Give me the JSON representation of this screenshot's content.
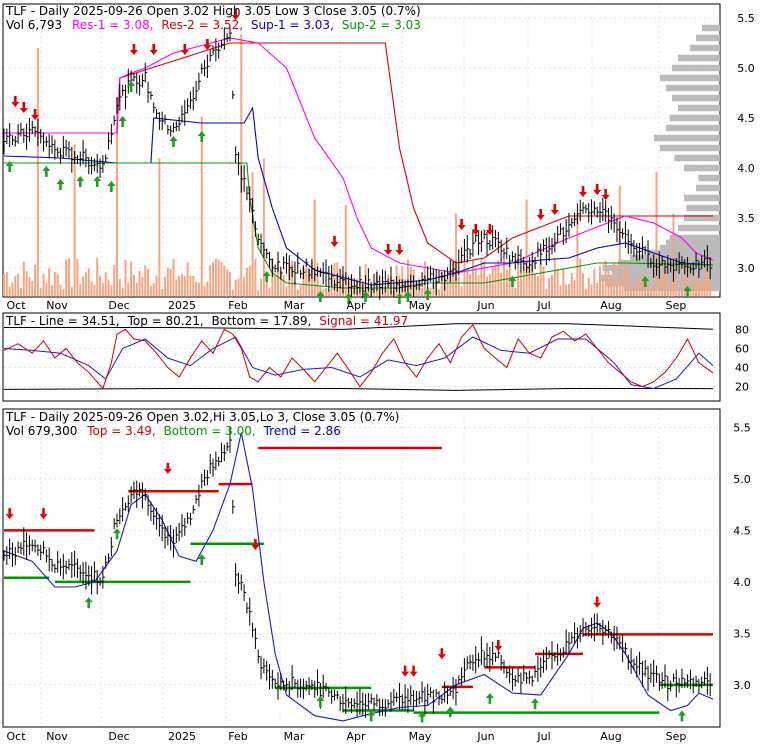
{
  "colors": {
    "res1": "#ff00ff",
    "res2": "#dd0000",
    "sup1": "#0000cc",
    "sup2": "#009900",
    "volume": "#f4a582",
    "volprofile": "#bbbbbb",
    "price": "#000000",
    "up_arrow": "#1f9e1f",
    "down_arrow": "#e00000",
    "signal": "#cc0000",
    "trend": "#1a1acc",
    "grid": "#cccccc"
  },
  "chart_data": [
    {
      "type": "line",
      "panel": "price-support-resistance",
      "header": {
        "title": "TLF - Daily 2025-09-26 Open 3.02  High 3.05  Low 3  Close 3.05 (0.7%)",
        "vol": "Vol 6,793",
        "res1": "Res-1 = 3.08,",
        "res2": "Res-2 = 3.52,",
        "sup1": "Sup-1 = 3.03,",
        "sup2": "Sup-2 = 3.03"
      },
      "x_tick_labels": [
        "Oct",
        "Nov",
        "Dec",
        "2025",
        "Feb",
        "Mar",
        "Apr",
        "May",
        "Jun",
        "Jul",
        "Aug",
        "Sep"
      ],
      "y_tick_labels": [
        "5.5",
        "5.0",
        "4.5",
        "4.0",
        "3.5",
        "3.0"
      ],
      "ylim": [
        2.72,
        5.62
      ],
      "x_range": [
        0,
        251
      ],
      "price_anchors": {
        "x": [
          0,
          10,
          18,
          28,
          35,
          40,
          45,
          50,
          52,
          55,
          58,
          62,
          66,
          70,
          74,
          78,
          80,
          82,
          87,
          90,
          95,
          98,
          100,
          110,
          120,
          130,
          140,
          150,
          160,
          162,
          168,
          175,
          180,
          185,
          190,
          195,
          200,
          205,
          210,
          215,
          220,
          228,
          235,
          240,
          245,
          251
        ],
        "y": [
          4.25,
          4.38,
          4.18,
          4.1,
          4.02,
          4.65,
          4.85,
          4.9,
          4.7,
          4.5,
          4.4,
          4.45,
          4.65,
          4.95,
          5.15,
          5.3,
          5.35,
          4.1,
          3.7,
          3.25,
          3.05,
          2.98,
          3.02,
          2.98,
          2.85,
          2.82,
          2.85,
          2.88,
          2.95,
          3.1,
          3.3,
          3.25,
          3.1,
          3.05,
          3.15,
          3.3,
          3.4,
          3.55,
          3.6,
          3.5,
          3.3,
          3.1,
          3.02,
          3.05,
          3.02,
          3.05
        ]
      },
      "volume_spikes": {
        "x": [
          12,
          25,
          40,
          55,
          70,
          84,
          88,
          92,
          110,
          121,
          160,
          185,
          203,
          218,
          231,
          237
        ],
        "y": [
          0.9,
          0.55,
          0.72,
          0.5,
          0.65,
          0.95,
          0.45,
          0.5,
          0.35,
          0.33,
          0.3,
          0.35,
          0.3,
          0.4,
          0.45,
          0.3
        ]
      },
      "res1": {
        "x": [
          0,
          40,
          41,
          45,
          50,
          60,
          80,
          90,
          100,
          110,
          120,
          125,
          130,
          140,
          160,
          180,
          200,
          220,
          230,
          240,
          245,
          251
        ],
        "y": [
          4.35,
          4.35,
          4.9,
          4.95,
          5.0,
          5.15,
          5.3,
          5.25,
          5.0,
          4.3,
          3.9,
          3.5,
          3.2,
          3.05,
          2.95,
          3.05,
          3.3,
          3.52,
          3.45,
          3.3,
          3.15,
          3.08
        ]
      },
      "res2": {
        "x": [
          0,
          40,
          41,
          80,
          120,
          135,
          140,
          145,
          150,
          160,
          170,
          180,
          200,
          220,
          251
        ],
        "y": [
          4.35,
          4.35,
          4.9,
          5.25,
          5.25,
          5.25,
          4.2,
          3.6,
          3.25,
          3.05,
          3.1,
          3.3,
          3.52,
          3.52,
          3.52
        ]
      },
      "sup1": {
        "x": [
          0,
          20,
          40,
          52,
          53,
          70,
          75,
          85,
          88,
          90,
          95,
          100,
          110,
          130,
          150,
          160,
          165,
          170,
          180,
          190,
          200,
          210,
          220,
          230,
          240,
          251
        ],
        "y": [
          4.12,
          4.1,
          4.05,
          4.05,
          4.5,
          4.45,
          4.45,
          4.45,
          4.6,
          4.1,
          3.6,
          3.2,
          2.98,
          2.83,
          2.88,
          2.95,
          3.0,
          3.05,
          3.05,
          3.08,
          3.1,
          3.2,
          3.25,
          3.15,
          3.05,
          3.03
        ]
      },
      "sup2": {
        "x": [
          0,
          86,
          87,
          90,
          95,
          100,
          120,
          140,
          150,
          170,
          180,
          190,
          200,
          210,
          215,
          220,
          251
        ],
        "y": [
          4.05,
          4.05,
          3.7,
          3.2,
          2.95,
          2.85,
          2.8,
          2.8,
          2.85,
          2.85,
          2.9,
          2.95,
          3.0,
          3.05,
          3.05,
          3.05,
          3.03
        ]
      },
      "up_arrows": {
        "x": [
          2,
          15,
          20,
          27,
          33,
          38,
          42,
          45,
          60,
          70,
          93,
          112,
          122,
          128,
          140,
          143,
          150,
          180,
          227,
          242
        ],
        "y": [
          4.1,
          4.05,
          3.92,
          3.95,
          3.95,
          3.9,
          4.55,
          4.9,
          4.35,
          4.4,
          3.0,
          2.8,
          2.78,
          2.8,
          2.78,
          2.8,
          2.82,
          2.95,
          2.95,
          2.85
        ]
      },
      "down_arrows": {
        "x": [
          4,
          7,
          11,
          46,
          53,
          64,
          72,
          82,
          117,
          136,
          140,
          162,
          167,
          172,
          190,
          195,
          205,
          210,
          213
        ],
        "y": [
          4.58,
          4.52,
          4.45,
          5.1,
          5.1,
          5.1,
          5.15,
          5.45,
          3.18,
          3.1,
          3.1,
          3.35,
          3.3,
          3.3,
          3.45,
          3.5,
          3.68,
          3.7,
          3.65
        ]
      },
      "volume_profile": {
        "price": [
          2.8,
          2.85,
          2.9,
          2.95,
          3.0,
          3.05,
          3.1,
          3.15,
          3.2,
          3.25,
          3.3,
          3.4,
          3.5,
          3.6,
          3.7,
          3.8,
          3.9,
          4.0,
          4.1,
          4.2,
          4.3,
          4.4,
          4.5,
          4.6,
          4.7,
          4.8,
          4.9,
          5.0,
          5.1,
          5.2,
          5.3,
          5.4
        ],
        "weight": [
          0.8,
          0.95,
          1.0,
          0.9,
          0.98,
          0.85,
          0.75,
          0.6,
          0.5,
          0.45,
          0.42,
          0.35,
          0.3,
          0.28,
          0.3,
          0.2,
          0.18,
          0.3,
          0.38,
          0.5,
          0.55,
          0.45,
          0.42,
          0.35,
          0.4,
          0.45,
          0.5,
          0.4,
          0.35,
          0.25,
          0.2,
          0.15
        ]
      }
    },
    {
      "type": "line",
      "panel": "oscillator",
      "header": {
        "title": "TLF - Line = 34.51,",
        "top": "Top = 80.21,",
        "bottom": "Bottom = 17.89,",
        "signal": "Signal = 41.97"
      },
      "y_tick_labels": [
        "80",
        "60",
        "40",
        "20"
      ],
      "ylim": [
        8,
        92
      ],
      "x_range": [
        0,
        251
      ],
      "line": {
        "x": [
          0,
          5,
          10,
          14,
          18,
          22,
          26,
          30,
          35,
          38,
          40,
          43,
          46,
          50,
          54,
          58,
          62,
          66,
          70,
          74,
          78,
          81,
          84,
          87,
          90,
          94,
          98,
          102,
          106,
          110,
          114,
          118,
          122,
          126,
          130,
          134,
          138,
          142,
          146,
          150,
          154,
          158,
          162,
          166,
          170,
          174,
          178,
          182,
          186,
          190,
          194,
          198,
          202,
          206,
          210,
          214,
          218,
          222,
          226,
          230,
          234,
          238,
          242,
          246,
          251
        ],
        "y": [
          58,
          65,
          55,
          68,
          50,
          60,
          45,
          35,
          18,
          45,
          75,
          80,
          70,
          68,
          55,
          40,
          30,
          50,
          68,
          55,
          80,
          75,
          60,
          30,
          25,
          40,
          30,
          50,
          38,
          25,
          40,
          55,
          38,
          20,
          35,
          55,
          70,
          45,
          30,
          50,
          65,
          45,
          72,
          85,
          60,
          50,
          40,
          70,
          55,
          50,
          72,
          78,
          68,
          75,
          60,
          45,
          35,
          25,
          20,
          25,
          35,
          50,
          70,
          45,
          34.51
        ]
      },
      "signal": {
        "x": [
          0,
          10,
          20,
          30,
          36,
          42,
          50,
          58,
          66,
          74,
          82,
          88,
          96,
          106,
          116,
          126,
          136,
          146,
          156,
          166,
          176,
          186,
          196,
          206,
          216,
          222,
          230,
          238,
          246,
          251
        ],
        "y": [
          60,
          58,
          55,
          42,
          28,
          60,
          70,
          50,
          42,
          60,
          72,
          40,
          32,
          38,
          40,
          30,
          48,
          42,
          50,
          72,
          58,
          55,
          70,
          70,
          45,
          22,
          18,
          28,
          55,
          41.97
        ]
      },
      "top_band": {
        "x": [
          0,
          60,
          120,
          160,
          200,
          251
        ],
        "y": [
          82,
          82,
          80,
          86,
          86,
          80.21
        ]
      },
      "bottom_band": {
        "x": [
          0,
          60,
          120,
          160,
          200,
          251
        ],
        "y": [
          17,
          18,
          18,
          16,
          18,
          17.89
        ]
      }
    },
    {
      "type": "line",
      "panel": "price-trend",
      "header": {
        "title": "TLF - Daily 2025-09-26 Open 3.02,Hi 3.05,Lo 3,  Close 3.05 (0.7%)",
        "vol": "Vol 679,300",
        "top": "Top = 3.49,",
        "bottom": "Bottom = 3.00,",
        "trend": "Trend = 2.86"
      },
      "x_tick_labels": [
        "Oct",
        "Nov",
        "Dec",
        "2025",
        "Feb",
        "Mar",
        "Apr",
        "May",
        "Jun",
        "Jul",
        "Aug",
        "Sep"
      ],
      "y_tick_labels": [
        "5.5",
        "5.0",
        "4.5",
        "4.0",
        "3.5",
        "3.0"
      ],
      "ylim": [
        2.6,
        5.65
      ],
      "x_range": [
        0,
        251
      ],
      "trend": {
        "x": [
          0,
          10,
          18,
          25,
          32,
          40,
          45,
          50,
          56,
          62,
          68,
          74,
          80,
          84,
          88,
          92,
          96,
          100,
          110,
          120,
          130,
          140,
          150,
          160,
          170,
          180,
          190,
          200,
          205,
          210,
          215,
          220,
          228,
          236,
          242,
          246,
          251
        ],
        "y": [
          4.3,
          4.2,
          3.95,
          3.95,
          4.0,
          4.3,
          4.75,
          4.85,
          4.6,
          4.25,
          4.2,
          4.5,
          4.95,
          5.45,
          4.9,
          4.0,
          3.3,
          2.9,
          2.7,
          2.65,
          2.72,
          2.78,
          2.8,
          3.0,
          3.1,
          2.92,
          2.9,
          3.3,
          3.55,
          3.6,
          3.5,
          3.3,
          2.9,
          2.75,
          2.8,
          2.92,
          2.86
        ]
      },
      "resistance_segments": [
        {
          "x": [
            0,
            32
          ],
          "y": [
            4.5,
            4.5
          ]
        },
        {
          "x": [
            44,
            76
          ],
          "y": [
            4.88,
            4.88
          ]
        },
        {
          "x": [
            76,
            88
          ],
          "y": [
            4.95,
            4.95
          ]
        },
        {
          "x": [
            90,
            155
          ],
          "y": [
            5.3,
            5.3
          ]
        },
        {
          "x": [
            155,
            166
          ],
          "y": [
            2.98,
            2.98
          ]
        },
        {
          "x": [
            170,
            188
          ],
          "y": [
            3.17,
            3.17
          ]
        },
        {
          "x": [
            188,
            205
          ],
          "y": [
            3.3,
            3.3
          ]
        },
        {
          "x": [
            205,
            251
          ],
          "y": [
            3.49,
            3.49
          ]
        }
      ],
      "support_segments": [
        {
          "x": [
            0,
            16
          ],
          "y": [
            4.04,
            4.04
          ]
        },
        {
          "x": [
            18,
            66
          ],
          "y": [
            4.0,
            4.0
          ]
        },
        {
          "x": [
            66,
            92
          ],
          "y": [
            4.37,
            4.37
          ]
        },
        {
          "x": [
            96,
            130
          ],
          "y": [
            2.97,
            2.97
          ]
        },
        {
          "x": [
            120,
            145
          ],
          "y": [
            2.75,
            2.75
          ]
        },
        {
          "x": [
            145,
            232
          ],
          "y": [
            2.73,
            2.73
          ]
        },
        {
          "x": [
            232,
            251
          ],
          "y": [
            3.0,
            3.0
          ]
        }
      ],
      "up_arrows": {
        "x": [
          40,
          70,
          30,
          112,
          130,
          148,
          158,
          172,
          188,
          240
        ],
        "y": [
          4.55,
          4.3,
          3.88,
          2.92,
          2.78,
          2.77,
          2.82,
          2.95,
          2.9,
          2.78
        ]
      },
      "down_arrows": {
        "x": [
          2,
          14,
          58,
          89,
          142,
          145,
          155,
          175,
          210
        ],
        "y": [
          4.58,
          4.58,
          5.02,
          4.28,
          3.05,
          3.05,
          3.22,
          3.3,
          3.72
        ]
      }
    }
  ]
}
